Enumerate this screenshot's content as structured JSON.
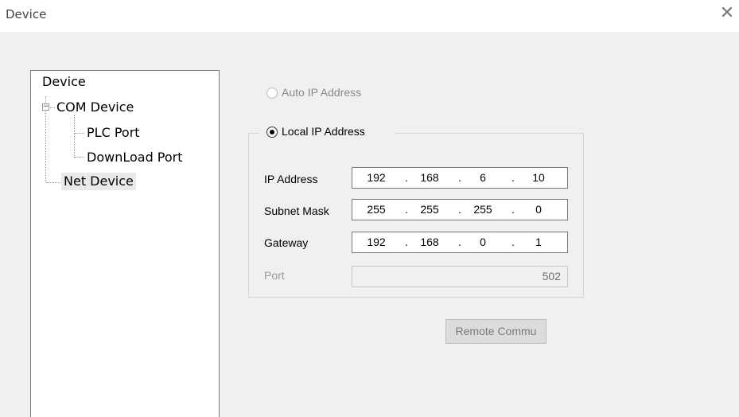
{
  "window": {
    "title": "Device",
    "close_glyph": "✕"
  },
  "tree": {
    "root": "Device",
    "com_device": "COM Device",
    "plc_port": "PLC Port",
    "download_port": "DownLoad Port",
    "net_device": "Net Device"
  },
  "ip_mode": {
    "auto_label": "Auto IP Address",
    "local_label": "Local IP Address",
    "selected": "local"
  },
  "fields": {
    "ip_label": "IP Address",
    "ip": [
      "192",
      "168",
      "6",
      "10"
    ],
    "mask_label": "Subnet Mask",
    "mask": [
      "255",
      "255",
      "255",
      "0"
    ],
    "gateway_label": "Gateway",
    "gateway": [
      "192",
      "168",
      "0",
      "1"
    ],
    "port_label": "Port",
    "port": "502",
    "separator": "."
  },
  "buttons": {
    "remote": "Remote Commu"
  }
}
